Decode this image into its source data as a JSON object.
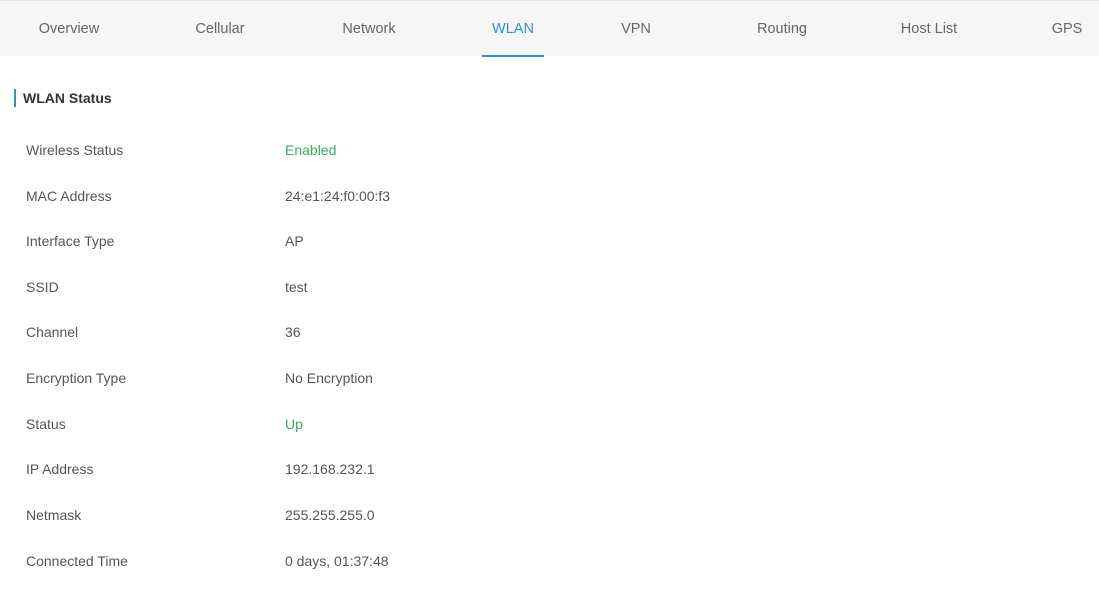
{
  "tabs": {
    "overview": "Overview",
    "cellular": "Cellular",
    "network": "Network",
    "wlan": "WLAN",
    "vpn": "VPN",
    "routing": "Routing",
    "host_list": "Host List",
    "gps": "GPS",
    "active": "WLAN"
  },
  "section_title": "WLAN Status",
  "colors": {
    "accent": "#2a8fd6",
    "status_ok": "#2fb05c"
  },
  "rows": [
    {
      "label": "Wireless Status",
      "value": "Enabled"
    },
    {
      "label": "MAC Address",
      "value": "24:e1:24:f0:00:f3"
    },
    {
      "label": "Interface Type",
      "value": "AP"
    },
    {
      "label": "SSID",
      "value": "test"
    },
    {
      "label": "Channel",
      "value": "36"
    },
    {
      "label": "Encryption Type",
      "value": "No Encryption"
    },
    {
      "label": "Status",
      "value": "Up"
    },
    {
      "label": "IP Address",
      "value": "192.168.232.1"
    },
    {
      "label": "Netmask",
      "value": "255.255.255.0"
    },
    {
      "label": "Connected Time",
      "value": "0 days, 01:37:48"
    }
  ]
}
